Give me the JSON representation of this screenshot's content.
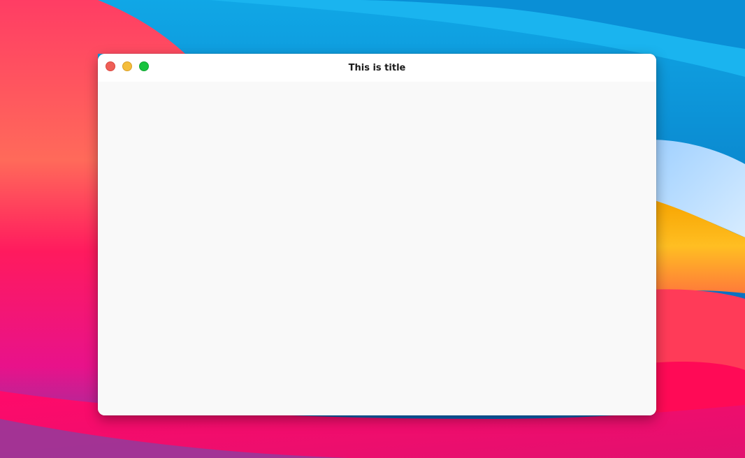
{
  "window": {
    "title": "This is title",
    "controls": [
      {
        "name": "close",
        "color": "#ef5f57"
      },
      {
        "name": "minimize",
        "color": "#f4bd3b"
      },
      {
        "name": "zoom",
        "color": "#18c33e"
      }
    ]
  },
  "colors": {
    "window_background": "#f9f9f9",
    "titlebar_background": "#ffffff",
    "title_text": "#1b1b1b"
  }
}
